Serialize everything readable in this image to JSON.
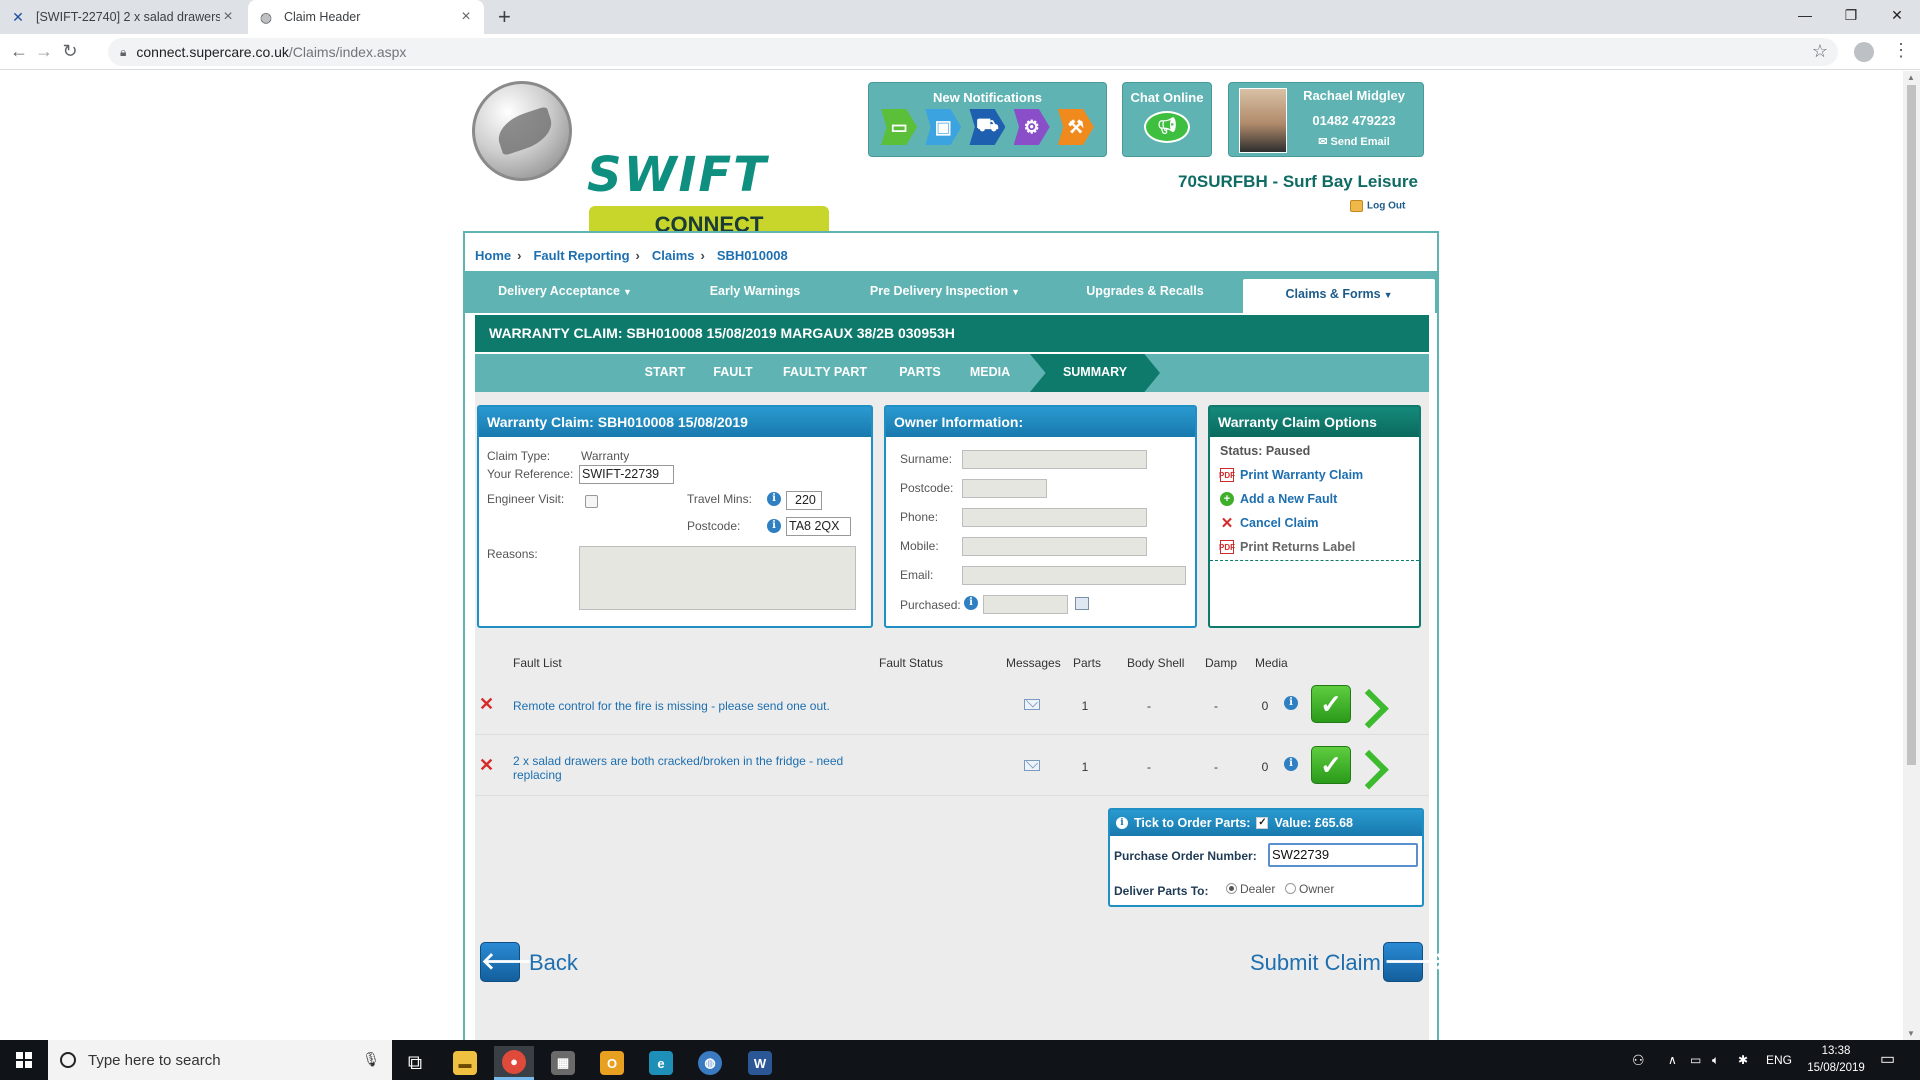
{
  "browser": {
    "tabs": [
      {
        "title": "[SWIFT-22740] 2 x salad drawers",
        "icon": "jira-icon",
        "active": false
      },
      {
        "title": "Claim Header",
        "icon": "globe-icon",
        "active": true
      }
    ],
    "url_host": "connect.supercare.co.uk",
    "url_path": "/Claims/index.aspx"
  },
  "header": {
    "logo_text": "SWIFT",
    "logo_sub": "CONNECT",
    "notifications_title": "New Notifications",
    "notification_icons": [
      "caravan-icon",
      "monitor-icon",
      "truck-icon",
      "gear-icon",
      "tools-icon"
    ],
    "chat_title": "Chat Online",
    "contact_name": "Rachael Midgley",
    "contact_phone": "01482 479223",
    "send_email": "Send Email",
    "dealer": "70SURFBH - Surf Bay Leisure",
    "logout": "Log Out"
  },
  "breadcrumb": [
    "Home",
    "Fault Reporting",
    "Claims",
    "SBH010008"
  ],
  "menu": [
    {
      "label": "Delivery Acceptance",
      "dropdown": true
    },
    {
      "label": "Early Warnings",
      "dropdown": false
    },
    {
      "label": "Pre Delivery Inspection",
      "dropdown": true
    },
    {
      "label": "Upgrades & Recalls",
      "dropdown": false
    },
    {
      "label": "Claims & Forms",
      "dropdown": true,
      "active": true
    }
  ],
  "claim_title": "WARRANTY CLAIM: SBH010008 15/08/2019 MARGAUX 38/2B 030953H",
  "steps": [
    "START",
    "FAULT",
    "FAULTY PART",
    "PARTS",
    "MEDIA",
    "SUMMARY"
  ],
  "active_step": "SUMMARY",
  "claim_panel": {
    "title": "Warranty Claim: SBH010008 15/08/2019",
    "claim_type_label": "Claim Type:",
    "claim_type": "Warranty",
    "reference_label": "Your Reference:",
    "reference": "SWIFT-22739",
    "engineer_label": "Engineer Visit:",
    "engineer_checked": false,
    "travel_label": "Travel Mins:",
    "travel_mins": "220",
    "postcode_label": "Postcode:",
    "postcode": "TA8 2QX",
    "reasons_label": "Reasons:",
    "reasons": ""
  },
  "owner_panel": {
    "title": "Owner Information:",
    "surname_label": "Surname:",
    "postcode_label": "Postcode:",
    "phone_label": "Phone:",
    "mobile_label": "Mobile:",
    "email_label": "Email:",
    "purchased_label": "Purchased:",
    "surname": "",
    "postcode": "",
    "phone": "",
    "mobile": "",
    "email": "",
    "purchased": ""
  },
  "options_panel": {
    "title": "Warranty Claim Options",
    "status": "Status: Paused",
    "links": [
      {
        "label": "Print Warranty Claim",
        "icon": "pdf-icon",
        "enabled": true
      },
      {
        "label": "Add a New Fault",
        "icon": "add-icon",
        "enabled": true
      },
      {
        "label": "Cancel Claim",
        "icon": "cross-icon",
        "enabled": true
      },
      {
        "label": "Print Returns Label",
        "icon": "pdf-icon",
        "enabled": false
      }
    ]
  },
  "fault_table": {
    "headers": [
      "Fault List",
      "Fault Status",
      "Messages",
      "Parts",
      "Body Shell",
      "Damp",
      "Media"
    ],
    "rows": [
      {
        "description": "Remote control for the fire is missing - please send one out.",
        "status": "",
        "parts": "1",
        "body_shell": "-",
        "damp": "-",
        "media": "0"
      },
      {
        "description": "2 x salad drawers are both cracked/broken in the fridge - need replacing",
        "status": "",
        "parts": "1",
        "body_shell": "-",
        "damp": "-",
        "media": "0"
      }
    ]
  },
  "order_parts": {
    "tick_label": "Tick to Order Parts:",
    "ticked": true,
    "value_label": "Value: £65.68",
    "po_label": "Purchase Order Number:",
    "po_number": "SW22739",
    "deliver_label": "Deliver Parts To:",
    "deliver_options": [
      "Dealer",
      "Owner"
    ],
    "deliver_selected": "Dealer"
  },
  "buttons": {
    "back": "Back",
    "submit": "Submit Claim"
  },
  "taskbar": {
    "search_placeholder": "Type here to search",
    "language": "ENG",
    "time": "13:38",
    "date": "15/08/2019"
  },
  "colors": {
    "teal": "#5fb3b3",
    "dark_teal": "#0e7a6c",
    "panel_blue": "#1879ad",
    "link_blue": "#1d6fb0"
  }
}
